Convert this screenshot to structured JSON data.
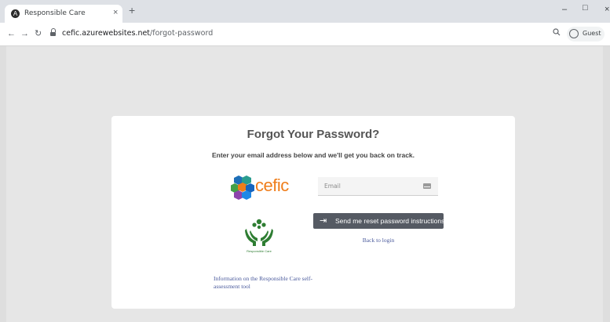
{
  "browser": {
    "tab_title": "Responsible Care",
    "tab_close": "×",
    "new_tab": "+",
    "url_domain": "cefic.azurewebsites.net",
    "url_path": "/forgot-password",
    "profile_label": "Guest",
    "icons": [
      "back-arrow-icon",
      "forward-arrow-icon",
      "reload-icon",
      "lock-icon",
      "zoom-icon",
      "profile-icon",
      "minimize-icon",
      "maximize-icon",
      "close-window-icon"
    ]
  },
  "page": {
    "title": "Forgot Your Password?",
    "subtitle": "Enter your email address below and we'll get you back on track.",
    "cefic_logo_text": "cefic",
    "rc_logo_caption": "Responsible Care",
    "email_placeholder": "Email",
    "send_button_label": "Send me reset password instructions",
    "back_link": "Back to login",
    "info_link": "Information on the Responsible Care self-assessment tool"
  },
  "colors": {
    "background": "#e6e6e6",
    "card": "#ffffff",
    "button": "#555a63",
    "link": "#4a5a9c",
    "cefic_orange": "#ef7d1a",
    "cefic_blue": "#1565c0",
    "rc_green": "#2e7d32"
  }
}
